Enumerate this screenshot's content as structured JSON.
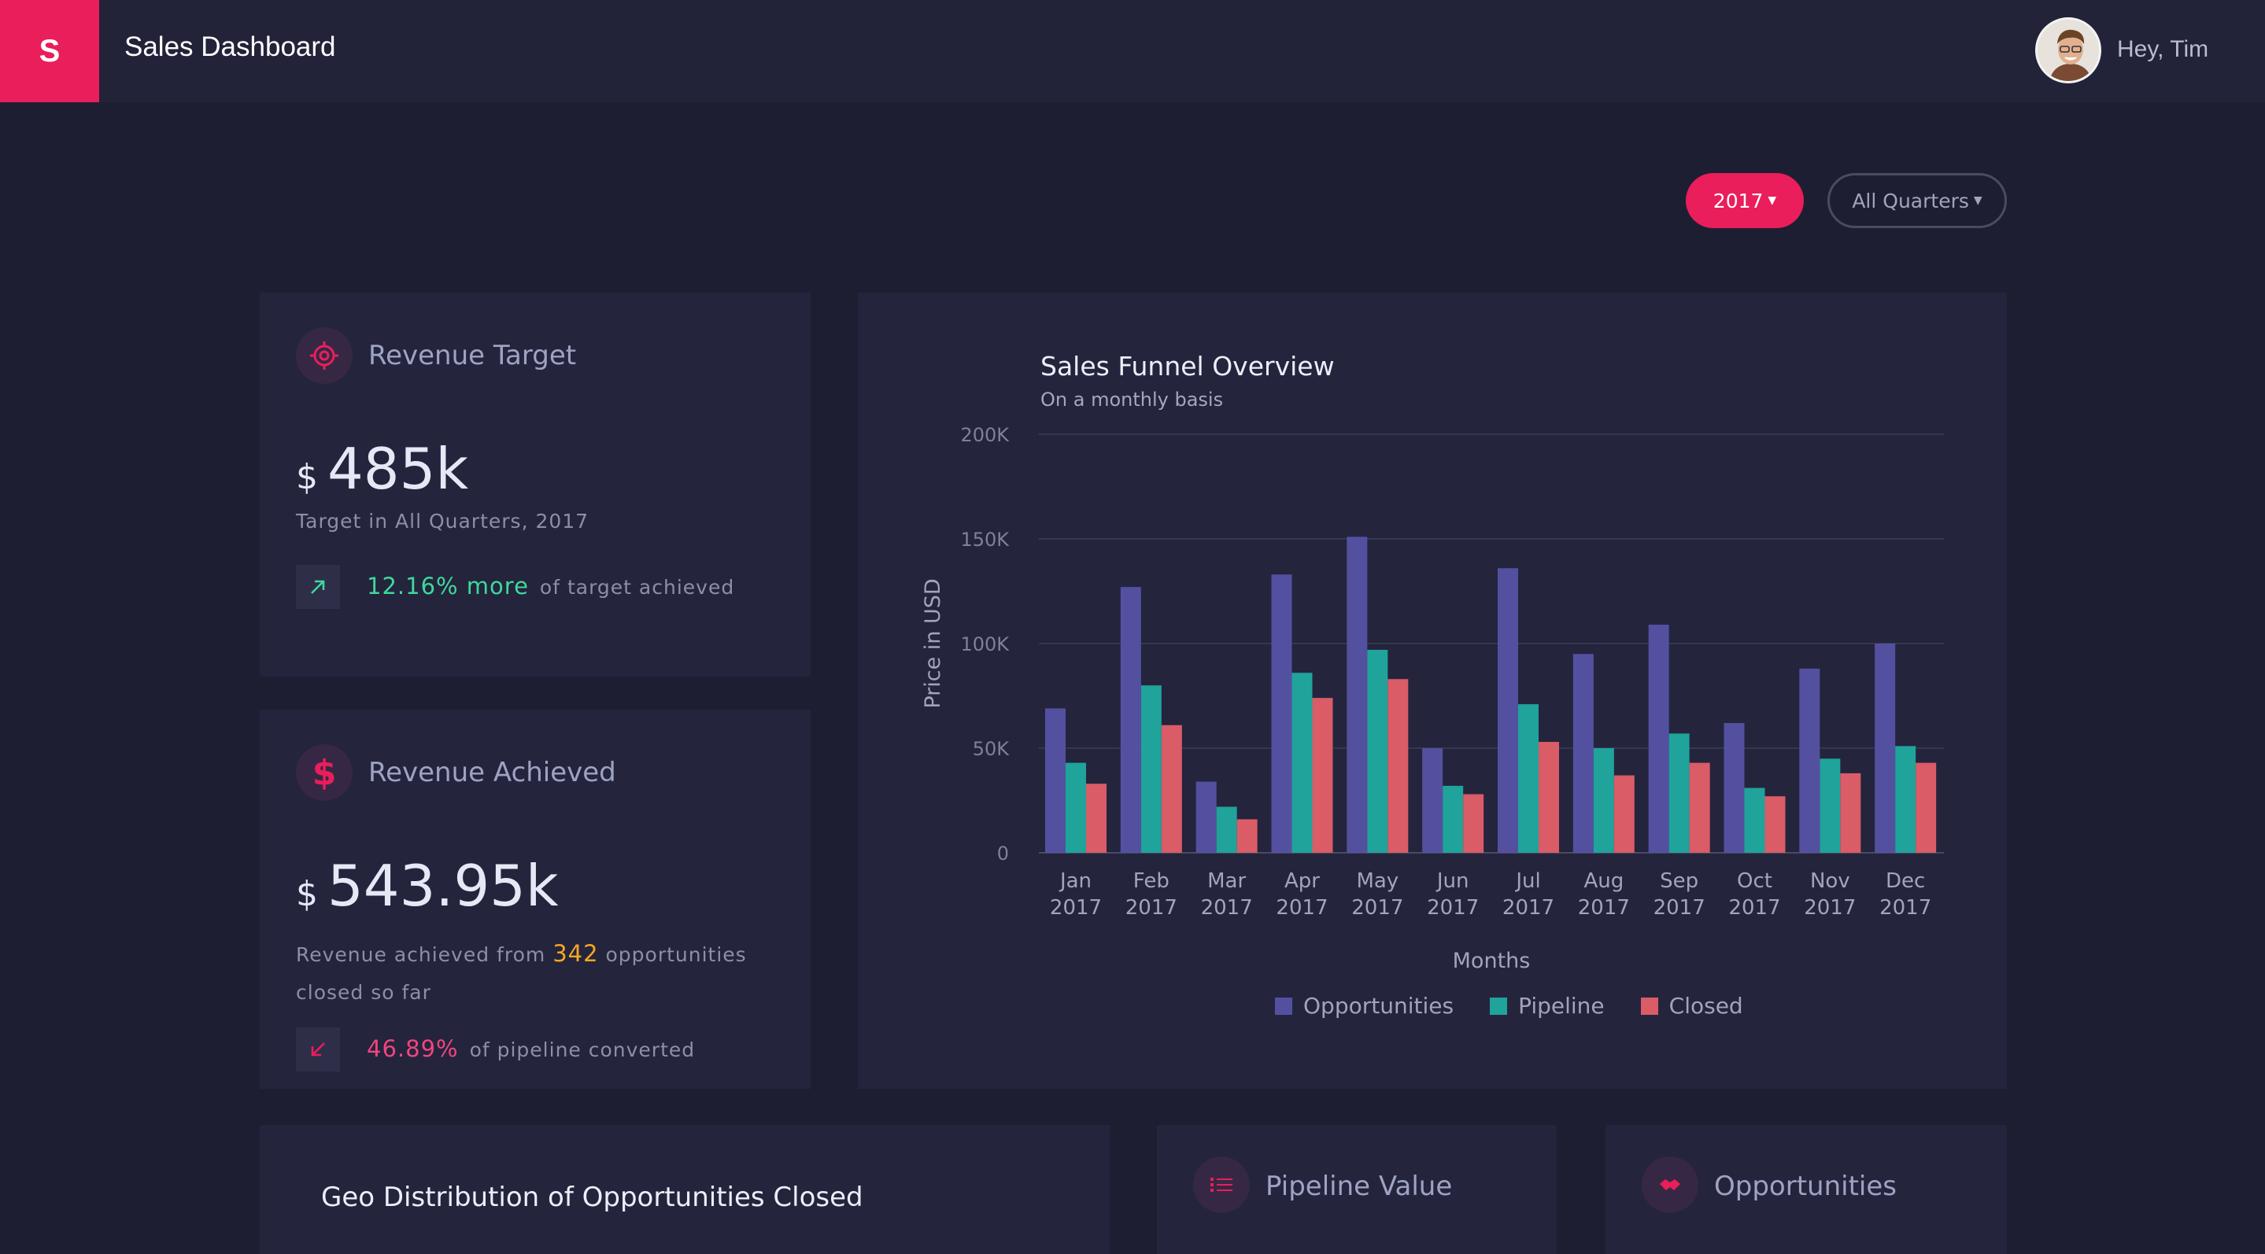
{
  "app": {
    "logo_letter": "S",
    "title": "Sales Dashboard",
    "greeting": "Hey, Tim"
  },
  "filters": {
    "year": "2017",
    "quarter": "All Quarters"
  },
  "revenue_target": {
    "title": "Revenue Target",
    "currency": "$",
    "value": "485k",
    "caption": "Target in All Quarters, 2017",
    "change": "12.16% more",
    "change_suffix": "of target achieved"
  },
  "revenue_achieved": {
    "title": "Revenue Achieved",
    "currency": "$",
    "value": "543.95k",
    "caption_prefix": "Revenue achieved from",
    "count": "342",
    "caption_suffix": "opportunities",
    "caption_line2": "closed so far",
    "percent": "46.89%",
    "percent_suffix": "of pipeline converted"
  },
  "bottom_cards": {
    "geo_title": "Geo Distribution of Opportunities Closed",
    "pipeline_title": "Pipeline Value",
    "opportunities_title": "Opportunities"
  },
  "colors": {
    "accent": "#e91e5b",
    "positive": "#3fd89a",
    "highlight": "#f5a623"
  },
  "chart_data": {
    "type": "bar",
    "title": "Sales Funnel Overview",
    "subtitle": "On a monthly basis",
    "xlabel": "Months",
    "ylabel": "Price in USD",
    "ylim": [
      0,
      200000
    ],
    "yticks": [
      "0",
      "50K",
      "100K",
      "150K",
      "200K"
    ],
    "ytick_values": [
      0,
      50000,
      100000,
      150000,
      200000
    ],
    "grid": true,
    "legend_position": "bottom",
    "categories": [
      [
        "Jan",
        "2017"
      ],
      [
        "Feb",
        "2017"
      ],
      [
        "Mar",
        "2017"
      ],
      [
        "Apr",
        "2017"
      ],
      [
        "May",
        "2017"
      ],
      [
        "Jun",
        "2017"
      ],
      [
        "Jul",
        "2017"
      ],
      [
        "Aug",
        "2017"
      ],
      [
        "Sep",
        "2017"
      ],
      [
        "Oct",
        "2017"
      ],
      [
        "Nov",
        "2017"
      ],
      [
        "Dec",
        "2017"
      ]
    ],
    "series": [
      {
        "name": "Opportunities",
        "color": "#5450a0",
        "values": [
          69000,
          127000,
          34000,
          133000,
          151000,
          50000,
          136000,
          95000,
          109000,
          62000,
          88000,
          100000
        ]
      },
      {
        "name": "Pipeline",
        "color": "#1fa39b",
        "values": [
          43000,
          80000,
          22000,
          86000,
          97000,
          32000,
          71000,
          50000,
          57000,
          31000,
          45000,
          51000
        ]
      },
      {
        "name": "Closed",
        "color": "#d95c67",
        "values": [
          33000,
          61000,
          16000,
          74000,
          83000,
          28000,
          53000,
          37000,
          43000,
          27000,
          38000,
          43000
        ]
      }
    ]
  }
}
